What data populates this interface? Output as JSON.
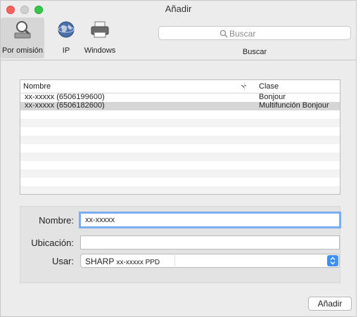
{
  "window": {
    "title": "Añadir"
  },
  "toolbar": {
    "buttons": [
      {
        "label": "Por omisión",
        "icon": "default-printer-icon",
        "selected": true
      },
      {
        "label": "IP",
        "icon": "globe-icon",
        "selected": false
      },
      {
        "label": "Windows",
        "icon": "windows-printer-icon",
        "selected": false
      }
    ],
    "search": {
      "placeholder": "Buscar",
      "label": "Buscar"
    }
  },
  "table": {
    "headers": {
      "name": "Nombre",
      "class": "Clase"
    },
    "rows": [
      {
        "name": "xx-xxxxx (6506199600)",
        "class": "Bonjour",
        "selected": false
      },
      {
        "name": "xx-xxxxx (6506182600)",
        "class": "Multifunción Bonjour",
        "selected": true
      }
    ]
  },
  "form": {
    "name_label": "Nombre:",
    "name_value": "xx-xxxxx",
    "location_label": "Ubicación:",
    "location_value": "",
    "use_label": "Usar:",
    "use_value_main": "SHARP",
    "use_value_model": "xx-xxxxx PPD"
  },
  "footer": {
    "add_button": "Añadir"
  },
  "colors": {
    "close": "#fc605c",
    "minimize": "#d0d0d0",
    "maximize": "#34c84a",
    "focus_ring": "#7aaef0",
    "select_accent": "#3f8ff5"
  }
}
